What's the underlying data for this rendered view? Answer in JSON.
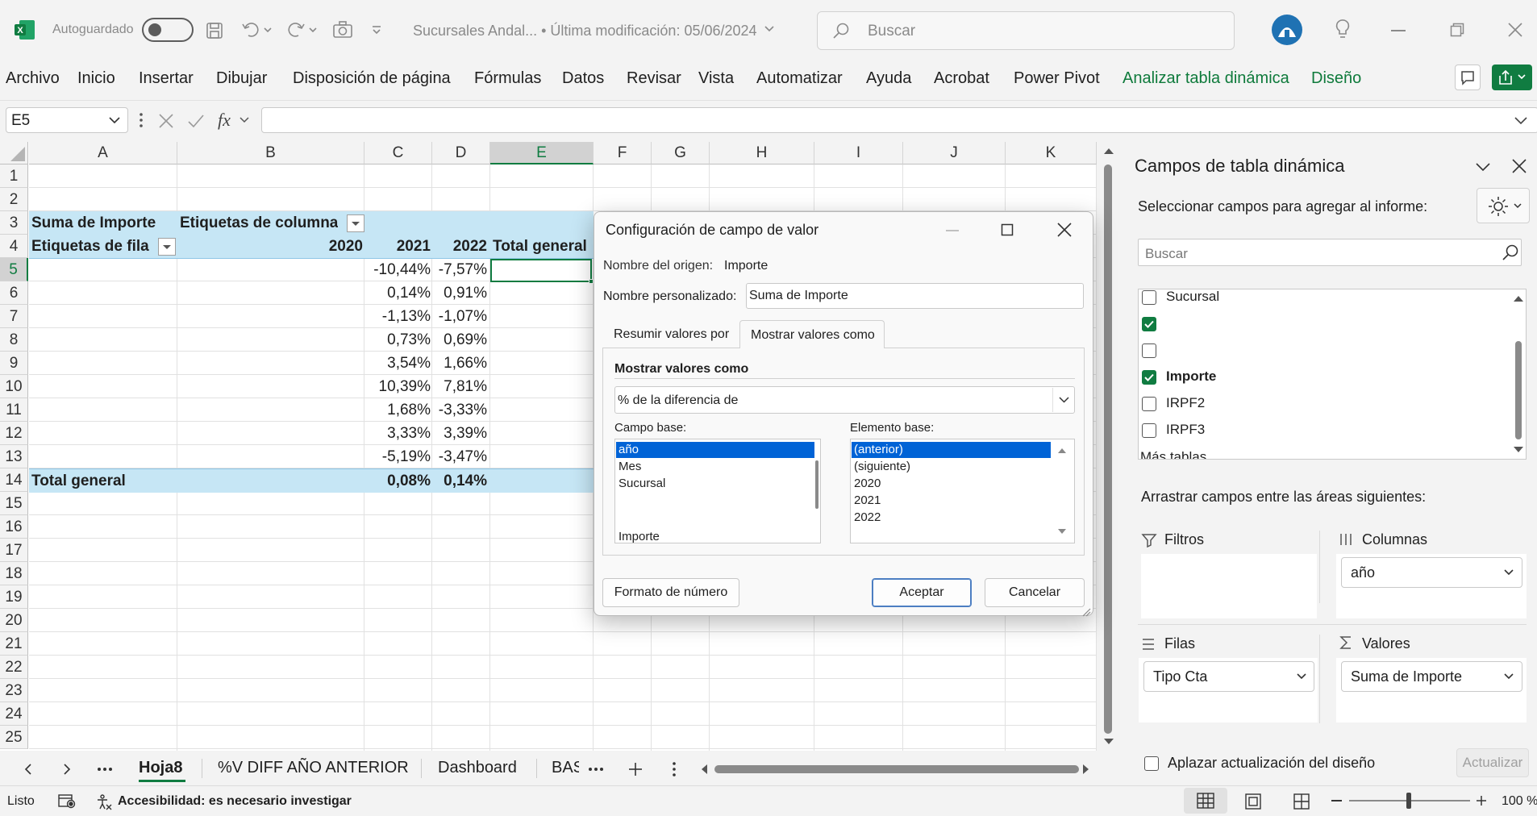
{
  "titlebar": {
    "autosave": "Autoguardado",
    "doc_title": "Sucursales Andal... • Última modificación: 05/06/2024",
    "search_placeholder": "Buscar"
  },
  "ribbon": {
    "tabs": [
      "Archivo",
      "Inicio",
      "Insertar",
      "Dibujar",
      "Disposición de página",
      "Fórmulas",
      "Datos",
      "Revisar",
      "Vista",
      "Automatizar",
      "Ayuda",
      "Acrobat",
      "Power Pivot",
      "Analizar tabla dinámica",
      "Diseño"
    ]
  },
  "formula_bar": {
    "name_box": "E5",
    "formula": ""
  },
  "grid": {
    "columns": [
      "A",
      "B",
      "C",
      "D",
      "E",
      "F",
      "G",
      "H",
      "I",
      "J",
      "K"
    ],
    "rows": [
      "1",
      "2",
      "3",
      "4",
      "5",
      "6",
      "7",
      "8",
      "9",
      "10",
      "11",
      "12",
      "13",
      "14",
      "15",
      "16",
      "17",
      "18",
      "19",
      "20",
      "21",
      "22",
      "23",
      "24",
      "25"
    ],
    "pivot": {
      "sum_label": "Suma de Importe",
      "col_labels": "Etiquetas de columna",
      "row_labels": "Etiquetas de fila",
      "years": [
        "2020",
        "2021",
        "2022"
      ],
      "total_header": "Total general",
      "data": [
        [
          "-10,44%",
          "-7,57%"
        ],
        [
          "0,14%",
          "0,91%"
        ],
        [
          "-1,13%",
          "-1,07%"
        ],
        [
          "0,73%",
          "0,69%"
        ],
        [
          "3,54%",
          "1,66%"
        ],
        [
          "10,39%",
          "7,81%"
        ],
        [
          "1,68%",
          "-3,33%"
        ],
        [
          "3,33%",
          "3,39%"
        ],
        [
          "-5,19%",
          "-3,47%"
        ]
      ],
      "total_row_label": "Total general",
      "total_row": [
        "0,08%",
        "0,14%"
      ]
    }
  },
  "dialog": {
    "title": "Configuración de campo de valor",
    "source_label": "Nombre del origen:",
    "source_value": "Importe",
    "custom_label": "Nombre personalizado:",
    "custom_value": "Suma de Importe",
    "tab_summarize": "Resumir valores por",
    "tab_show": "Mostrar valores como",
    "section_title": "Mostrar valores como",
    "show_as_value": "% de la diferencia de",
    "base_field_label": "Campo base:",
    "base_fields": [
      "año",
      "Mes",
      "Sucursal",
      "",
      "Importe"
    ],
    "base_item_label": "Elemento base:",
    "base_items": [
      "(anterior)",
      "(siguiente)",
      "2020",
      "2021",
      "2022"
    ],
    "number_format_button": "Formato de número",
    "ok_button": "Aceptar",
    "cancel_button": "Cancelar"
  },
  "pane": {
    "title": "Campos de tabla dinámica",
    "instruction": "Seleccionar campos para agregar al informe:",
    "search_placeholder": "Buscar",
    "fields": [
      {
        "label": "Sucursal",
        "checked": false
      },
      {
        "label": "",
        "checked": true
      },
      {
        "label": "",
        "checked": false
      },
      {
        "label": "Importe",
        "checked": true
      },
      {
        "label": "IRPF2",
        "checked": false
      },
      {
        "label": "IRPF3",
        "checked": false
      }
    ],
    "more_tables": "Más tablas",
    "drag_instruction": "Arrastrar campos entre las áreas siguientes:",
    "filters_label": "Filtros",
    "columns_label": "Columnas",
    "columns_value": "año",
    "rows_label": "Filas",
    "rows_value": "Tipo Cta",
    "values_label": "Valores",
    "values_value": "Suma de Importe",
    "defer_label": "Aplazar actualización del diseño",
    "update_button": "Actualizar"
  },
  "sheet_tabs": [
    "Hoja8",
    "%V DIFF AÑO ANTERIOR",
    "Dashboard",
    "BAS"
  ],
  "status": {
    "ready": "Listo",
    "accessibility": "Accesibilidad: es necesario investigar",
    "zoom": "100 %"
  },
  "colors": {
    "excel_green": "#107c41",
    "pivot_header": "#c6e6f5",
    "selection": "#0063d6"
  }
}
